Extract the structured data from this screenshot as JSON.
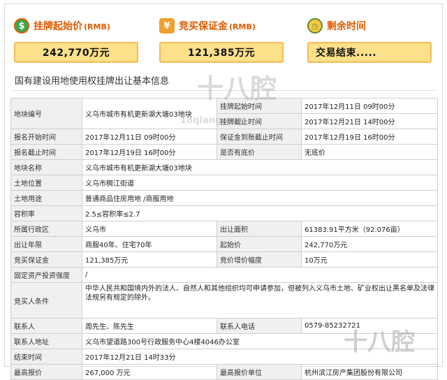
{
  "summary": {
    "start_price": {
      "icon": "money-bag-icon",
      "title": "挂牌起始价",
      "unit": "(RMB)",
      "value": "242,770万元"
    },
    "deposit": {
      "icon": "coins-icon",
      "title": "竞买保证金",
      "unit": "(RMB)",
      "value": "121,385万元"
    },
    "remaining": {
      "icon": "clock-icon",
      "title": "剩余时间",
      "value": "交易结束....."
    }
  },
  "section_title": "国有建设用地使用权挂牌出让基本信息",
  "info": {
    "plot_no": {
      "label": "地块编号",
      "value": "义乌市城市有机更新湖大塘03地块"
    },
    "listing_start": {
      "label": "挂牌起始时间",
      "value": "2017年12月11日 09时00分"
    },
    "listing_end": {
      "label": "挂牌截止时间",
      "value": "2017年12月21日 14时00分"
    },
    "apply_start": {
      "label": "报名开始时间",
      "value": "2017年12月11日 09时00分"
    },
    "deposit_deadline": {
      "label": "保证金到账截止时间",
      "value": "2017年12月19日 16时00分"
    },
    "apply_end": {
      "label": "报名截止时间",
      "value": "2017年12月19日 16时00分"
    },
    "reserve": {
      "label": "是否有底价",
      "value": "无底价"
    },
    "plot_name": {
      "label": "地块名称",
      "value": "义乌市城市有机更新湖大塘03地块"
    },
    "location": {
      "label": "土地位置",
      "value": "义乌市稠江街道"
    },
    "usage": {
      "label": "土地用途",
      "value": "普通商品住房用地 /商服用地"
    },
    "far": {
      "label": "容积率",
      "value": "2.5≤容积率≤2.7"
    },
    "district": {
      "label": "所属行政区",
      "value": "义乌市"
    },
    "area": {
      "label": "出让面积",
      "value": "61383.91平方米（92.076亩）"
    },
    "term": {
      "label": "出让年限",
      "value": "商服40年、住宅70年"
    },
    "start_price": {
      "label": "起始价",
      "value": "242,770万元"
    },
    "deposit": {
      "label": "竞买保证金",
      "value": "121,385万元"
    },
    "increment": {
      "label": "竞价增价幅度",
      "value": "10万元"
    },
    "investment": {
      "label": "固定资产投资强度",
      "value": "/"
    },
    "conditions": {
      "label": "竞买人条件",
      "value": "中华人民共和国境内外的法人、自然人和其他组织均可申请参加，但被列入义乌市土地、矿业权出让黑名单及法律法规另有规定的除外。"
    },
    "contact": {
      "label": "联系人",
      "value": "周先生、陈先生"
    },
    "phone": {
      "label": "联系人电话",
      "value": "0579-85232721"
    },
    "address": {
      "label": "联系人地址",
      "value": "义乌市望道路300号行政服务中心4楼4046办公室"
    },
    "end_time": {
      "label": "结束时间",
      "value": "2017年12月21日 14时33分"
    },
    "top_price": {
      "label": "最高报价",
      "value": "267,000 万元"
    },
    "top_bidder": {
      "label": "最高报价单位",
      "value": "杭州滨江房产集团股份有限公司"
    }
  },
  "watermark": {
    "text": "十八腔",
    "sub": "18qiang.com"
  }
}
